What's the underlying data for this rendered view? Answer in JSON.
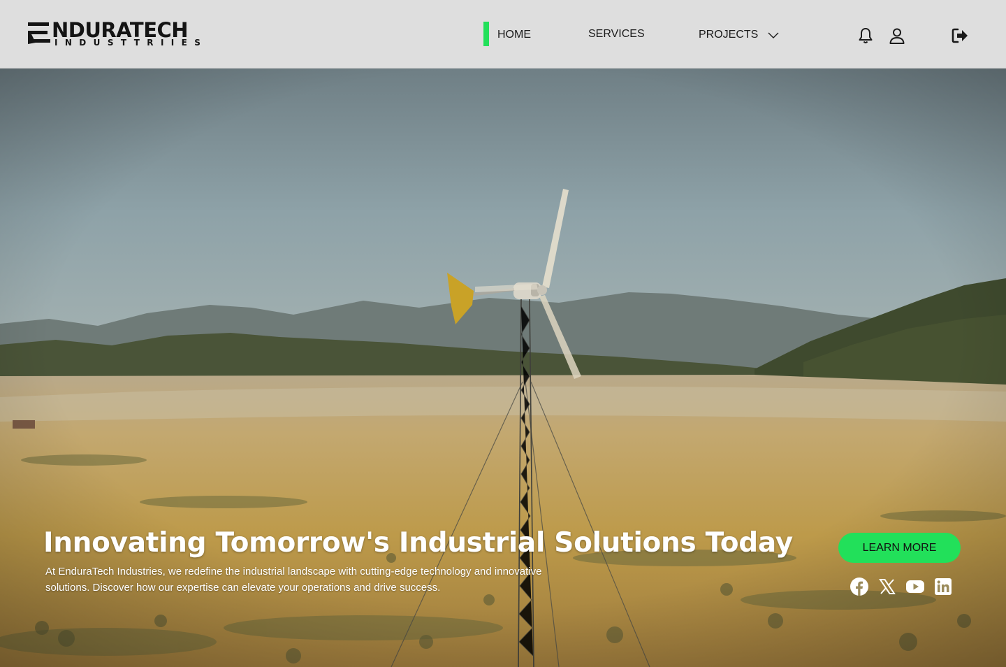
{
  "header": {
    "logo": {
      "name": "NDURATECH",
      "sub": "INDUSTTRIIES"
    },
    "nav": [
      {
        "label": "HOME",
        "active": true
      },
      {
        "label": "SERVICES"
      },
      {
        "label": "PROJECTS",
        "has_dropdown": true
      }
    ],
    "icons": [
      "bell-icon",
      "user-icon",
      "logout-icon"
    ],
    "accent": "#22e05a"
  },
  "hero": {
    "title": "Innovating Tomorrow's Industrial Solutions Today",
    "description": "At EnduraTech Industries, we redefine the industrial landscape with cutting-edge technology and innovative solutions. Discover how our expertise can elevate your operations and drive success.",
    "cta_label": "LEARN MORE",
    "socials": [
      "facebook-icon",
      "x-icon",
      "youtube-icon",
      "linkedin-icon"
    ],
    "background": "wind turbine on a dry plain with mountains"
  }
}
